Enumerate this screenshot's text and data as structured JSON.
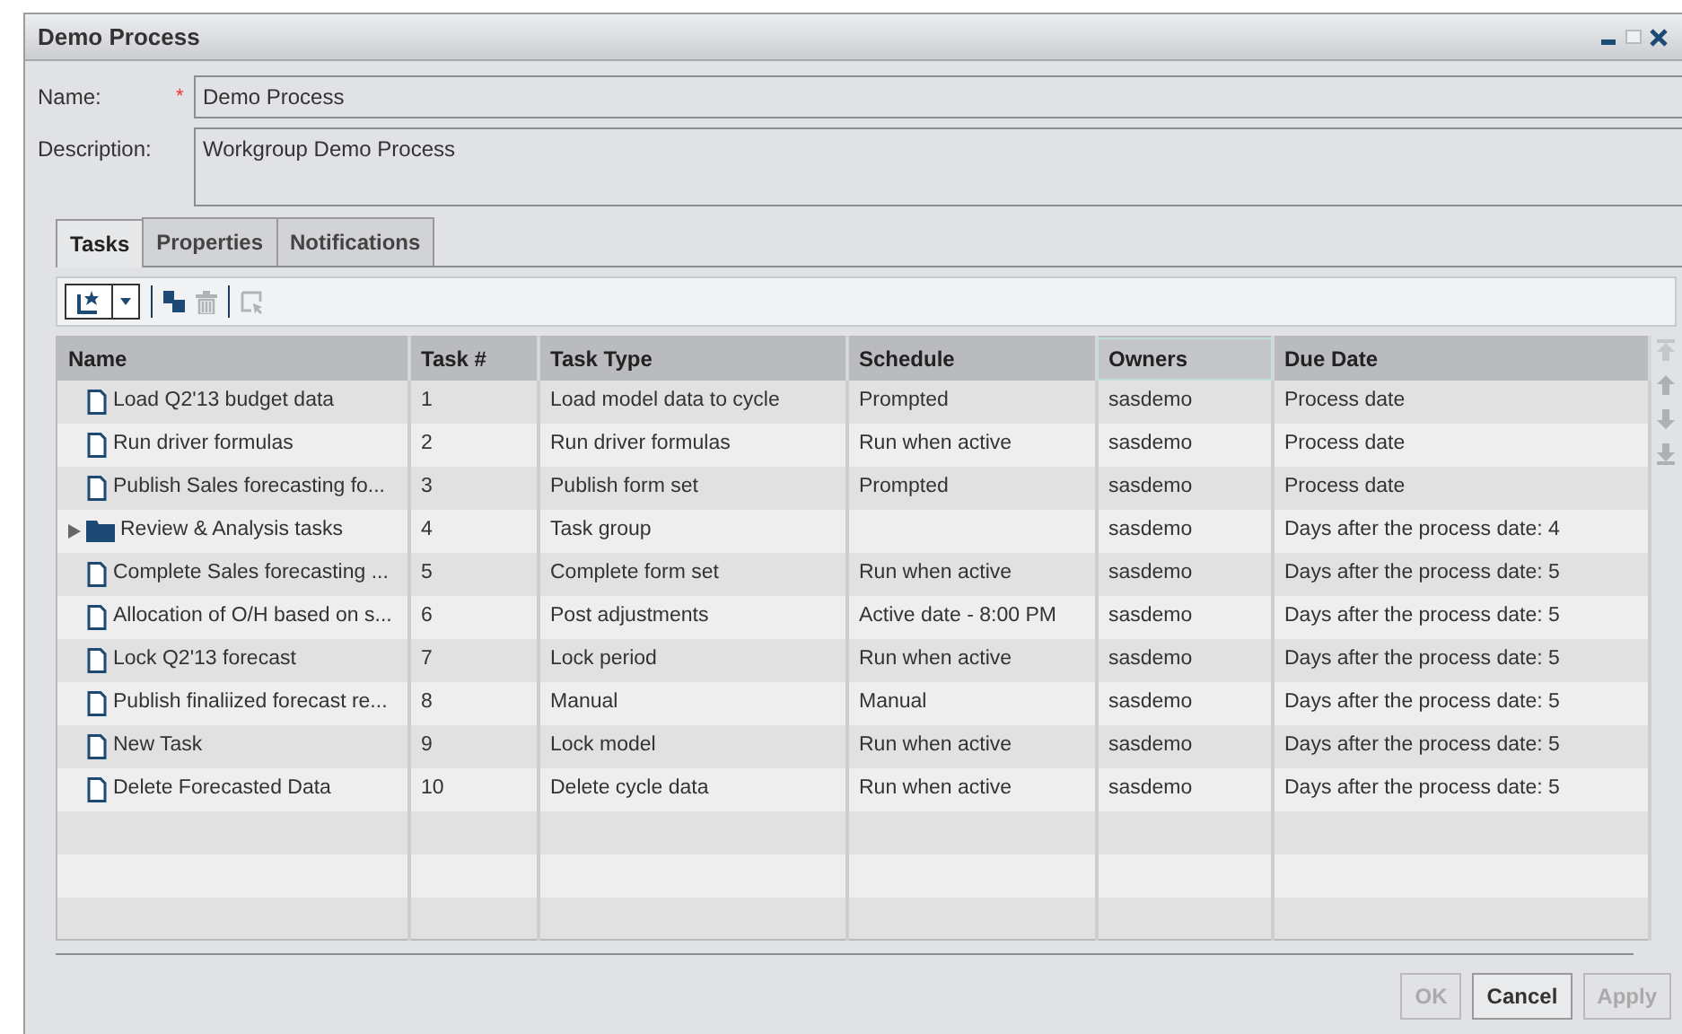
{
  "window": {
    "title": "Demo Process"
  },
  "form": {
    "name_label": "Name:",
    "required_mark": "*",
    "name_value": "Demo Process",
    "description_label": "Description:",
    "description_value": "Workgroup Demo Process"
  },
  "tabs": [
    {
      "label": "Tasks",
      "selected": true
    },
    {
      "label": "Properties",
      "selected": false
    },
    {
      "label": "Notifications",
      "selected": false
    }
  ],
  "toolbar": {
    "new_disabled": false,
    "copy_disabled": false,
    "delete_disabled": true,
    "select_disabled": true
  },
  "table": {
    "columns": [
      {
        "label": "Name",
        "focused": false
      },
      {
        "label": "Task #",
        "focused": false
      },
      {
        "label": "Task Type",
        "focused": false
      },
      {
        "label": "Schedule",
        "focused": false
      },
      {
        "label": "Owners",
        "focused": true
      },
      {
        "label": "Due Date",
        "focused": false
      }
    ],
    "rows": [
      {
        "kind": "task",
        "name": "Load Q2'13 budget data",
        "number": "1",
        "type": "Load model data to cycle",
        "schedule": "Prompted",
        "owner": "sasdemo",
        "due": "Process date"
      },
      {
        "kind": "task",
        "name": "Run driver formulas",
        "number": "2",
        "type": "Run driver formulas",
        "schedule": "Run when active",
        "owner": "sasdemo",
        "due": "Process date"
      },
      {
        "kind": "task",
        "name": "Publish Sales forecasting fo...",
        "number": "3",
        "type": "Publish form set",
        "schedule": "Prompted",
        "owner": "sasdemo",
        "due": "Process date"
      },
      {
        "kind": "group",
        "expanded": false,
        "name": "Review & Analysis tasks",
        "number": "4",
        "type": "Task group",
        "owner": "sasdemo",
        "due": "Days after the process date: 4"
      },
      {
        "kind": "task",
        "name": "Complete Sales forecasting ...",
        "number": "5",
        "type": "Complete form set",
        "schedule": "Run when active",
        "owner": "sasdemo",
        "due": "Days after the process date: 5"
      },
      {
        "kind": "task",
        "name": "Allocation of O/H based on s...",
        "number": "6",
        "type": "Post adjustments",
        "schedule": "Active date - 8:00 PM",
        "owner": "sasdemo",
        "due": "Days after the process date: 5"
      },
      {
        "kind": "task",
        "name": "Lock Q2'13 forecast",
        "number": "7",
        "type": "Lock period",
        "schedule": "Run when active",
        "owner": "sasdemo",
        "due": "Days after the process date: 5"
      },
      {
        "kind": "task",
        "name": "Publish finaliized forecast re...",
        "number": "8",
        "type": "Manual",
        "schedule": "Manual",
        "owner": "sasdemo",
        "due": "Days after the process date: 5"
      },
      {
        "kind": "task",
        "name": "New Task",
        "number": "9",
        "type": "Lock model",
        "schedule": "Run when active",
        "owner": "sasdemo",
        "due": "Days after the process date: 5"
      },
      {
        "kind": "task",
        "name": "Delete Forecasted Data",
        "number": "10",
        "type": "Delete cycle data",
        "schedule": "Run when active",
        "owner": "sasdemo",
        "due": "Days after the process date: 5"
      }
    ]
  },
  "buttons": [
    {
      "label": "OK",
      "disabled": true
    },
    {
      "label": "Cancel",
      "disabled": false
    },
    {
      "label": "Apply",
      "disabled": true
    }
  ]
}
